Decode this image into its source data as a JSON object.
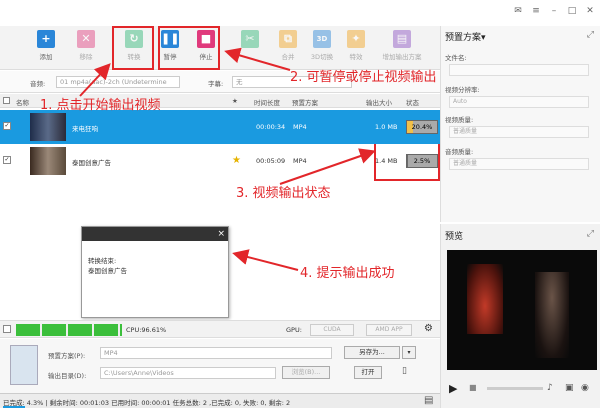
{
  "toolbar": {
    "add": "添加",
    "remove": "移除",
    "convert": "转换",
    "pause": "暂停",
    "stop": "停止",
    "merge": "合并",
    "convert3d": "3D切换",
    "special": "特效",
    "add_preset": "增加输出方案"
  },
  "options": {
    "audio_label": "音频:",
    "audio_value": "01 mp4a(aac)-2ch (Undetermine",
    "subtitle_label": "字幕:",
    "subtitle_value": "无"
  },
  "list_header": {
    "name": "名称",
    "star": "★",
    "duration": "时间长度",
    "preset": "预置方案",
    "size": "输出大小",
    "status": "状态"
  },
  "rows": [
    {
      "name": "来电狂响",
      "duration": "00:00:34",
      "format": "MP4",
      "size": "1.0 MB",
      "progress_text": "20.4%",
      "progress": 0.204,
      "starred": false
    },
    {
      "name": "泰国创意广告",
      "duration": "00:05:09",
      "format": "MP4",
      "size": "1.4 MB",
      "progress_text": "2.5%",
      "progress": 0.025,
      "starred": true
    }
  ],
  "annotations": {
    "a1": "1. 点击开始输出视频",
    "a2": "2. 可暂停或停止视频输出",
    "a3": "3. 视频输出状态",
    "a4": "4. 提示输出成功"
  },
  "popup": {
    "close": "×",
    "line1": "转换结束:",
    "line2": "泰国创意广告"
  },
  "preset_panel": {
    "title": "预置方案▾",
    "filename_label": "文件名:",
    "video_res_label": "视频分辨率:",
    "video_res_value": "Auto",
    "video_quality_label": "视频质量:",
    "video_quality_value": "普通质量",
    "audio_quality_label": "音频质量:",
    "audio_quality_value": "普通质量"
  },
  "preview": {
    "title": "预览"
  },
  "cpu": {
    "text": "CPU:96.61%",
    "gpu_label": "GPU:",
    "cuda": "CUDA",
    "amd": "AMD APP"
  },
  "bottom": {
    "preset_label": "预置方案(P):",
    "preset_value": "MP4",
    "save_as": "另存为...",
    "output_label": "输出目录(D):",
    "output_value": "C:\\Users\\Anne\\Videos",
    "browse": "浏览(B)...",
    "open": "打开"
  },
  "status": {
    "text": "已完成: 4.3% | 剩余时间: 00:01:03 已用时间: 00:00:01 任务总数: 2 ,已完成: 0, 失败: 0, 剩余: 2"
  },
  "colors": {
    "accent": "#1a9ae0",
    "annotation": "#e2262a"
  }
}
